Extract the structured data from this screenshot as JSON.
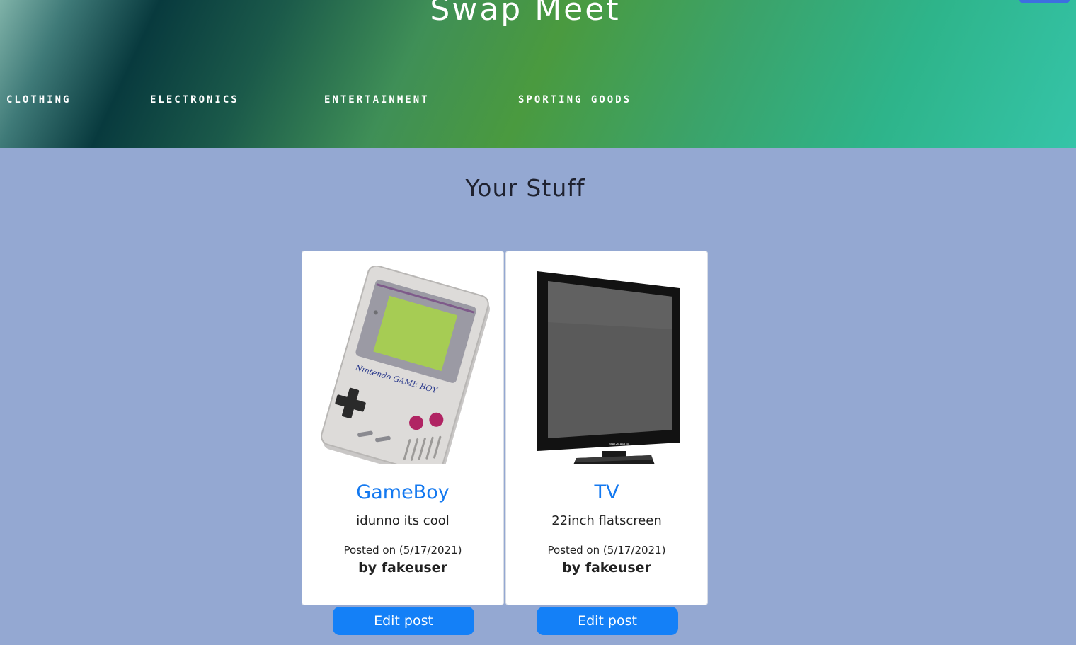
{
  "site": {
    "title": "Swap Meet"
  },
  "nav": {
    "items": [
      {
        "label": "CLOTHING"
      },
      {
        "label": "ELECTRONICS"
      },
      {
        "label": "ENTERTAINMENT"
      },
      {
        "label": "SPORTING GOODS"
      }
    ]
  },
  "main": {
    "heading": "Your Stuff",
    "posts": [
      {
        "title": "GameBoy",
        "description": "idunno its cool",
        "posted": "Posted on (5/17/2021)",
        "author": "by fakeuser",
        "edit_label": "Edit post",
        "image_icon": "gameboy-image"
      },
      {
        "title": "TV",
        "description": "22inch flatscreen",
        "posted": "Posted on (5/17/2021)",
        "author": "by fakeuser",
        "edit_label": "Edit post",
        "image_icon": "tv-image"
      }
    ]
  },
  "colors": {
    "page_background": "#94a8d2",
    "accent_blue": "#1480f7",
    "title_link": "#1479f0"
  }
}
